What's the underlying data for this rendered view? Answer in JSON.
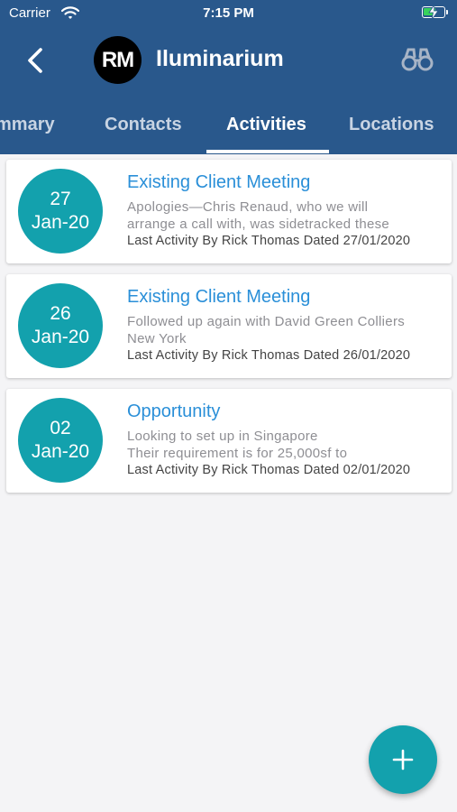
{
  "status_bar": {
    "carrier": "Carrier",
    "time": "7:15 PM"
  },
  "nav": {
    "avatar_text": "RM",
    "title": "Iluminarium"
  },
  "tabs": [
    {
      "label": "mmary",
      "active": false
    },
    {
      "label": "Contacts",
      "active": false
    },
    {
      "label": "Activities",
      "active": true
    },
    {
      "label": "Locations",
      "active": false
    }
  ],
  "activities": [
    {
      "day": "27",
      "month": "Jan-20",
      "title": "Existing Client Meeting",
      "description": [
        "Apologies—Chris Renaud, who we will",
        "arrange a call with, was sidetracked these"
      ],
      "meta": "Last Activity By Rick Thomas Dated 27/01/2020"
    },
    {
      "day": "26",
      "month": "Jan-20",
      "title": "Existing Client Meeting",
      "description": [
        "Followed up again with David Green Colliers",
        "New York"
      ],
      "meta": "Last Activity By Rick Thomas Dated 26/01/2020"
    },
    {
      "day": "02",
      "month": "Jan-20",
      "title": "Opportunity",
      "description": [
        "Looking to set up in Singapore",
        "Their requirement is for 25,000sf to"
      ],
      "meta": "Last Activity By Rick Thomas Dated 02/01/2020"
    }
  ],
  "colors": {
    "header": "#29588c",
    "accent": "#13a1ad",
    "title_link": "#2a8fd8"
  },
  "icons": {
    "back": "chevron-left-icon",
    "search": "binoculars-icon",
    "add": "plus-icon",
    "wifi": "wifi-icon",
    "battery": "battery-charging-icon"
  }
}
